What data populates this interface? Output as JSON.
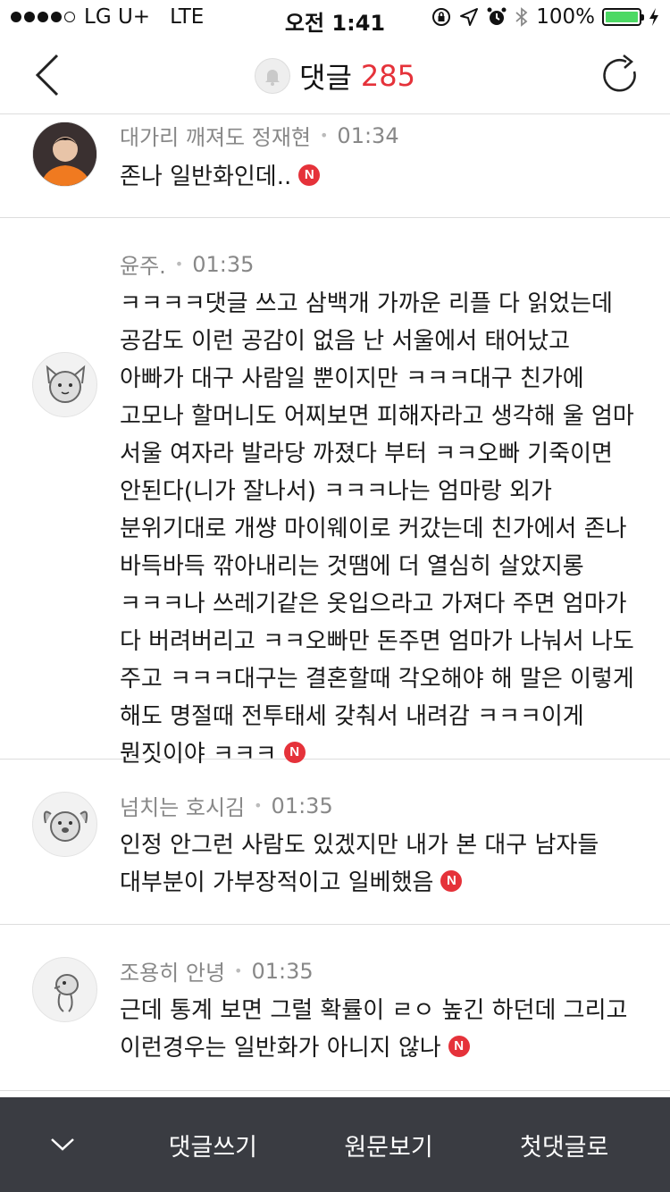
{
  "status_bar": {
    "carrier": "LG U+",
    "network": "LTE",
    "time": "오전 1:41",
    "battery": "100%"
  },
  "nav": {
    "title": "댓글",
    "count": "285"
  },
  "comments": [
    {
      "author": "대가리 깨져도 정재현",
      "time": "01:34",
      "text": "존나 일반화인데..",
      "badge": "N"
    },
    {
      "author": "윤주.",
      "time": "01:35",
      "text": "ㅋㅋㅋㅋ댓글 쓰고 삼백개 가까운 리플 다 읽었는데 공감도 이런 공감이 없음 난 서울에서 태어났고 아빠가 대구 사람일 뿐이지만 ㅋㅋㅋ대구 친가에 고모나 할머니도 어찌보면 피해자라고 생각해 울 엄마 서울 여자라 발라당 까졌다 부터 ㅋㅋ오빠 기죽이면 안된다(니가 잘나서) ㅋㅋㅋ나는 엄마랑 외가 분위기대로 개썅 마이웨이로 커갔는데 친가에서 존나 바득바득 깎아내리는 것땜에 더 열심히 살았지롱 ㅋㅋㅋ나 쓰레기같은 옷입으라고 가져다 주면 엄마가 다 버려버리고 ㅋㅋ오빠만 돈주면 엄마가 나눠서 나도 주고 ㅋㅋㅋ대구는 결혼할때 각오해야 해 말은 이렇게 해도 명절때 전투태세 갖춰서 내려감 ㅋㅋㅋ이게 뭔짓이야 ㅋㅋㅋ",
      "badge": "N"
    },
    {
      "author": "넘치는 호시김",
      "time": "01:35",
      "text": "인정 안그런 사람도 있겠지만 내가 본 대구 남자들 대부분이 가부장적이고 일베했음",
      "badge": "N"
    },
    {
      "author": "조용히 안녕",
      "time": "01:35",
      "text": "근데 통계 보면 그럴 확률이 ㄹㅇ 높긴 하던데 그리고 이런경우는 일반화가 아니지 않나",
      "badge": "N"
    }
  ],
  "bottom_bar": {
    "write": "댓글쓰기",
    "view_original": "원문보기",
    "first_comment": "첫댓글로"
  }
}
